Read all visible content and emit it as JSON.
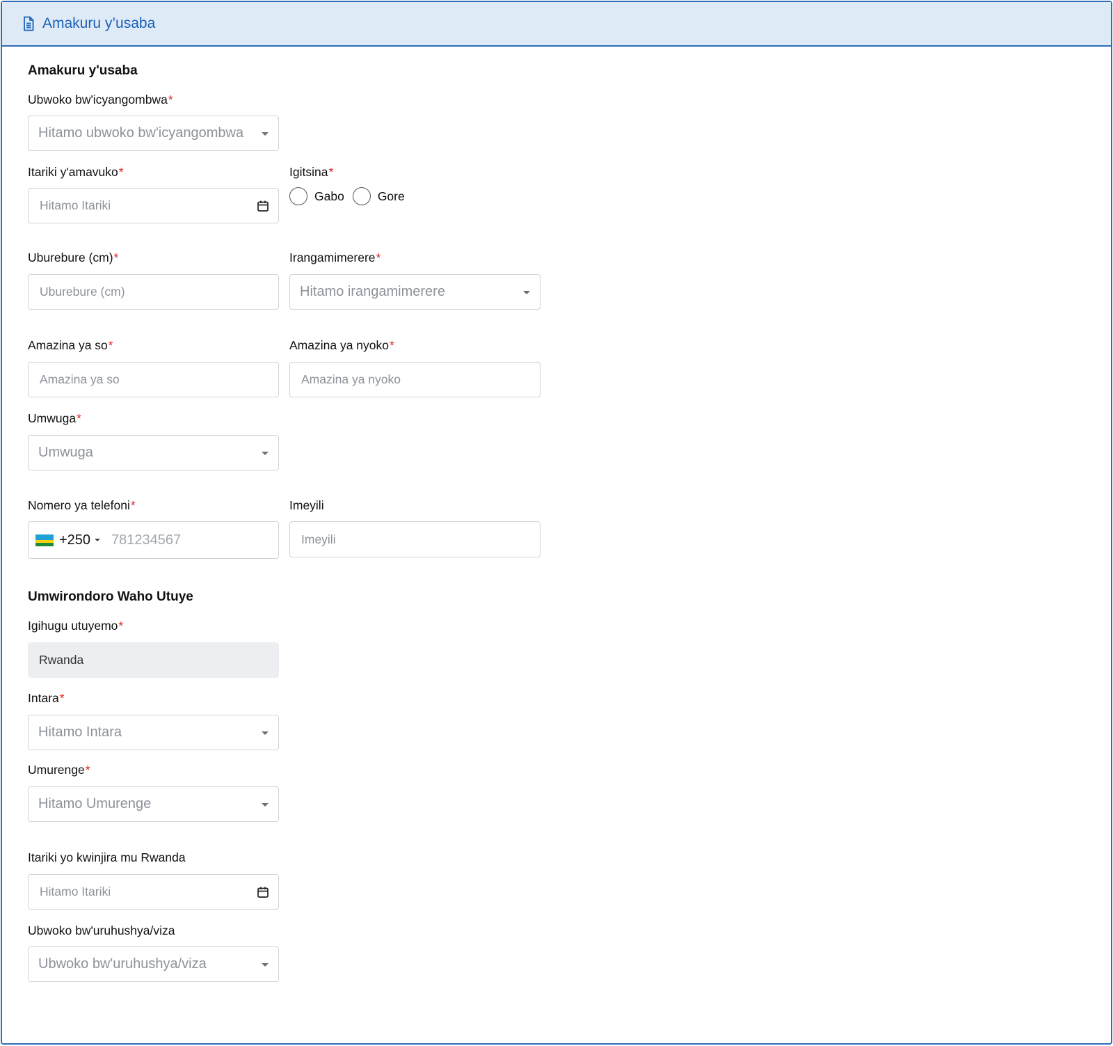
{
  "header": {
    "title": "Amakuru y’usaba",
    "icon": "document-icon"
  },
  "section1": {
    "title": "Amakuru y'usaba"
  },
  "fields": {
    "document_type": {
      "label": "Ubwoko bw'icyangombwa",
      "placeholder": "Hitamo ubwoko bw'icyangombwa"
    },
    "birth_date": {
      "label": "Itariki y'amavuko",
      "placeholder": "Hitamo Itariki"
    },
    "gender": {
      "label": "Igitsina",
      "options": [
        "Gabo",
        "Gore"
      ]
    },
    "height": {
      "label": "Uburebure (cm)",
      "placeholder": "Uburebure (cm)"
    },
    "marital_status": {
      "label": "Irangamimerere",
      "placeholder": "Hitamo irangamimerere"
    },
    "father_name": {
      "label": "Amazina ya so",
      "placeholder": "Amazina ya so"
    },
    "mother_name": {
      "label": "Amazina ya nyoko",
      "placeholder": "Amazina ya nyoko"
    },
    "occupation": {
      "label": "Umwuga",
      "placeholder": "Umwuga"
    },
    "phone": {
      "label": "Nomero ya telefoni",
      "dial_code": "+250",
      "placeholder": "781234567"
    },
    "email": {
      "label": "Imeyili",
      "placeholder": "Imeyili"
    }
  },
  "section2": {
    "title": "Umwirondoro Waho Utuye"
  },
  "residence": {
    "country": {
      "label": "Igihugu utuyemo",
      "value": "Rwanda"
    },
    "province": {
      "label": "Intara",
      "placeholder": "Hitamo Intara"
    },
    "sector": {
      "label": "Umurenge",
      "placeholder": "Hitamo Umurenge"
    },
    "entry_date": {
      "label": "Itariki yo kwinjira mu Rwanda",
      "placeholder": "Hitamo Itariki"
    },
    "visa_type": {
      "label": "Ubwoko bw'uruhushya/viza",
      "placeholder": "Ubwoko bw'uruhushya/viza"
    }
  },
  "required_marker": "*",
  "colors": {
    "accent": "#1a61b5",
    "header_bg": "#dfeaf7",
    "required": "#e02424",
    "border": "#2f6db8"
  }
}
